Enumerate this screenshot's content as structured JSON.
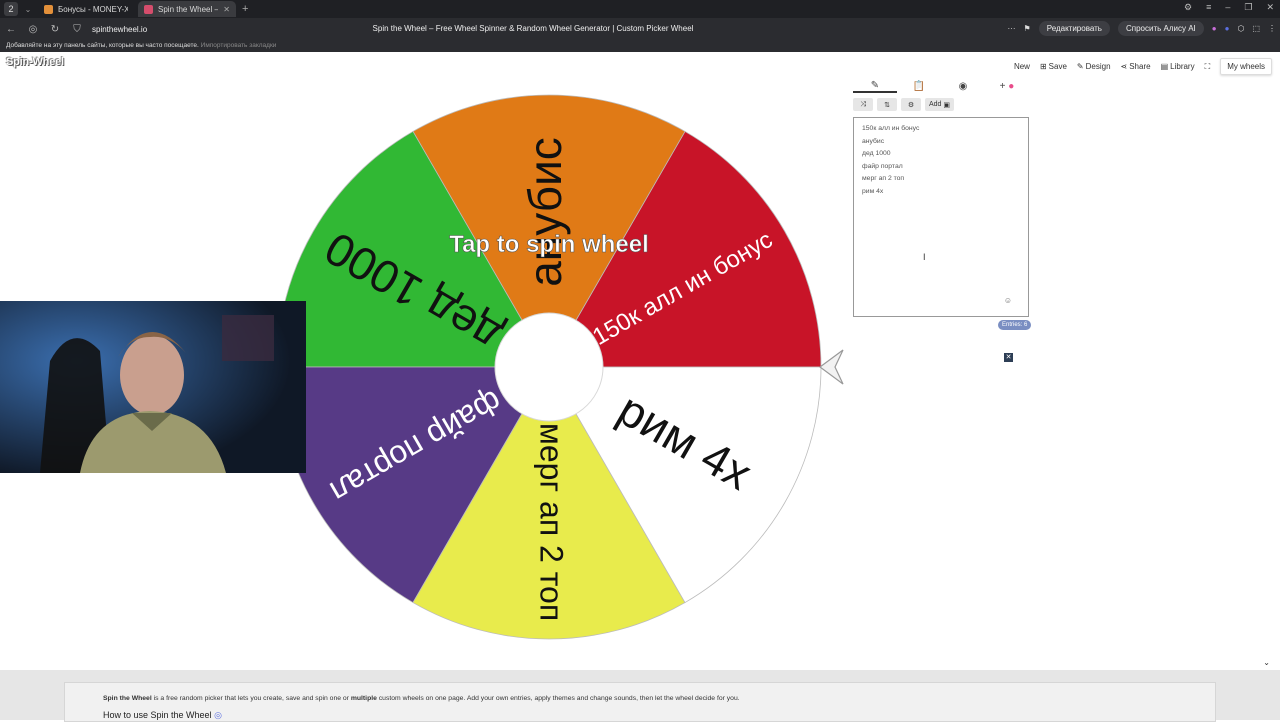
{
  "browser": {
    "tab_count": "2",
    "tabs": [
      {
        "label": "Бонусы - MONEY-X",
        "color": "#e3903a"
      },
      {
        "label": "Spin the Wheel – Free W",
        "color": "#d54d6c"
      }
    ],
    "url": "spinthewheel.io",
    "page_title": "Spin the Wheel – Free Wheel Spinner & Random Wheel Generator | Custom Picker Wheel",
    "edit_label": "Редактировать",
    "alice_label": "Спросить Алису AI",
    "bookmarks_text": "Добавляйте на эту панель сайты, которые вы часто посещаете.",
    "bookmarks_import": "Импортировать закладки"
  },
  "app": {
    "logo": "Spin-Wheel",
    "menu": {
      "new": "New",
      "save": "Save",
      "design": "Design",
      "share": "Share",
      "library": "Library",
      "my_wheels": "My wheels"
    }
  },
  "wheel": {
    "center_text": "Tap to spin wheel",
    "segments": [
      {
        "label": "150к алл ин бонус",
        "color": "#c81428"
      },
      {
        "label": "анубис",
        "color": "#e07a16"
      },
      {
        "label": "дед 1000",
        "color": "#31b834"
      },
      {
        "label": "файр портал",
        "color": "#573a86"
      },
      {
        "label": "мерг ап 2 топ",
        "color": "#e8eb4c"
      },
      {
        "label": "рим 4х",
        "color": "#ffffff"
      }
    ]
  },
  "editor": {
    "add_image_label": "Add",
    "entries": [
      "150к алл ин бонус",
      "анубис",
      "дед 1000",
      "файр портал",
      "мерг ап 2 топ",
      "рим 4х"
    ],
    "entries_count": "Entries: 6"
  },
  "footer": {
    "brand": "Spin the Wheel",
    "text1": " is a free random picker that lets you create, save and spin one or ",
    "bold2": "multiple",
    "text2": " custom wheels on one page. Add your own entries, apply themes and change sounds, then let the wheel decide for you.",
    "heading": "How to use Spin the Wheel"
  }
}
